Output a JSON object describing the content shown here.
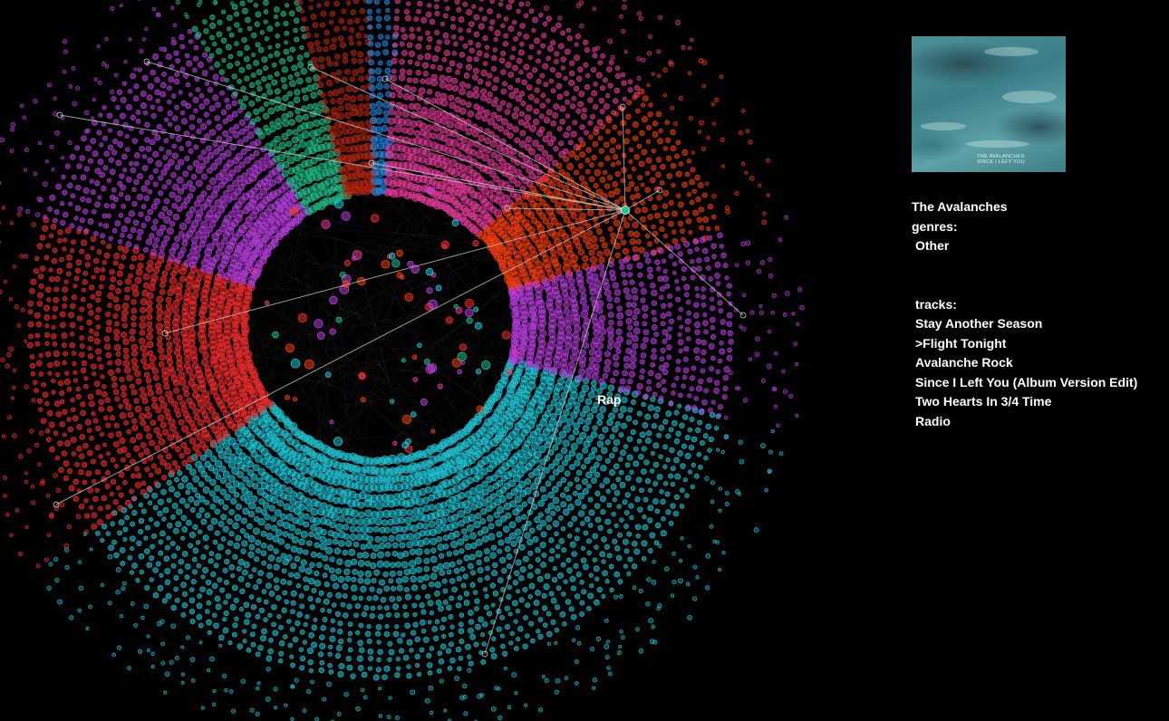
{
  "visualization": {
    "genre_label": "Rap",
    "genres_shown": [
      {
        "name": "violet",
        "color": "#c040e8"
      },
      {
        "name": "green",
        "color": "#20c890"
      },
      {
        "name": "dark-red",
        "color": "#c02810"
      },
      {
        "name": "blue",
        "color": "#1e90f0"
      },
      {
        "name": "pink",
        "color": "#f03ca0"
      },
      {
        "name": "orange-red",
        "color": "#ff4010"
      },
      {
        "name": "red",
        "color": "#ff3030"
      },
      {
        "name": "cyan",
        "color": "#20d0e0"
      }
    ]
  },
  "sidebar": {
    "album_cover": {
      "title_line1": "THE AVALANCHES",
      "title_line2": "SINCE I LEFT YOU"
    },
    "artist": "The Avalanches",
    "genres_label": "genres:",
    "genres": [
      "Other"
    ],
    "tracks_label": "tracks:",
    "tracks": [
      "Stay Another Season",
      ">Flight Tonight",
      "Avalanche Rock",
      "Since I Left You (Album Version Edit)",
      "Two Hearts In 3/4 Time",
      "Radio"
    ]
  }
}
